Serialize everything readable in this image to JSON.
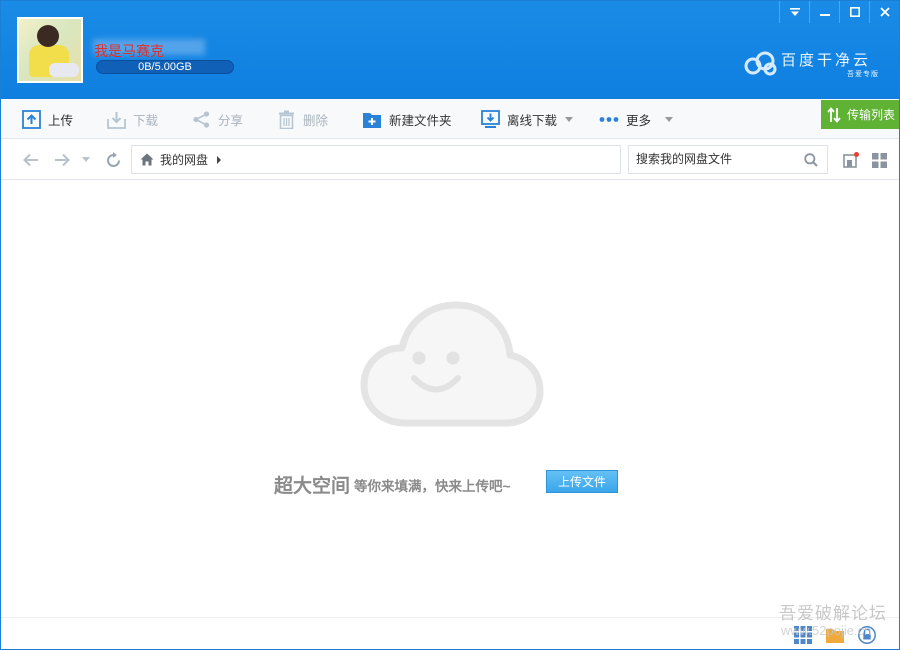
{
  "header": {
    "username": "我是马赛克",
    "quota": "0B/5.00GB",
    "logo_text": "百度干净云",
    "logo_sub": "吾爱专版"
  },
  "window_controls": [
    "menu-icon",
    "minimize-icon",
    "maximize-icon",
    "close-icon"
  ],
  "transfer_tab": {
    "label": "传输列表"
  },
  "toolbar": {
    "upload": "上传",
    "download": "下载",
    "share": "分享",
    "delete": "删除",
    "new_folder": "新建文件夹",
    "offline_download": "离线下载",
    "more": "更多"
  },
  "nav": {
    "breadcrumb_root": "我的网盘",
    "search_placeholder": "搜索我的网盘文件"
  },
  "empty_state": {
    "headline": "超大空间",
    "message": "等你来填满，快来上传吧~",
    "upload_button": "上传文件"
  },
  "watermark": {
    "text": "吾爱破解论坛",
    "url": "www.52pojie.cn"
  },
  "colors": {
    "header_blue": "#1a8be6",
    "transfer_green": "#5fb234",
    "accent_blue": "#3aa6ea",
    "username_red": "#e0302a"
  }
}
